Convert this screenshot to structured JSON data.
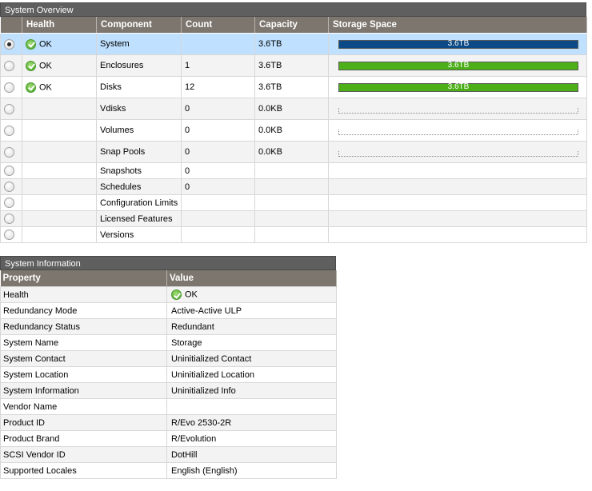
{
  "overview": {
    "title": "System Overview",
    "columns": {
      "select": "",
      "health": "Health",
      "component": "Component",
      "count": "Count",
      "capacity": "Capacity",
      "storage": "Storage Space"
    },
    "rows": [
      {
        "selected": true,
        "health": "OK",
        "component": "System",
        "count": "",
        "capacity": "3.6TB",
        "bar": "blue",
        "bar_label": "3.6TB",
        "fill": 1.0
      },
      {
        "selected": false,
        "health": "OK",
        "component": "Enclosures",
        "count": "1",
        "capacity": "3.6TB",
        "bar": "green",
        "bar_label": "3.6TB",
        "fill": 1.0
      },
      {
        "selected": false,
        "health": "OK",
        "component": "Disks",
        "count": "12",
        "capacity": "3.6TB",
        "bar": "green",
        "bar_label": "3.6TB",
        "fill": 1.0
      },
      {
        "selected": false,
        "health": "",
        "component": "Vdisks",
        "count": "0",
        "capacity": "0.0KB",
        "bar": "empty",
        "bar_label": "",
        "fill": 0
      },
      {
        "selected": false,
        "health": "",
        "component": "Volumes",
        "count": "0",
        "capacity": "0.0KB",
        "bar": "empty",
        "bar_label": "",
        "fill": 0
      },
      {
        "selected": false,
        "health": "",
        "component": "Snap Pools",
        "count": "0",
        "capacity": "0.0KB",
        "bar": "empty",
        "bar_label": "",
        "fill": 0
      },
      {
        "selected": false,
        "health": "",
        "component": "Snapshots",
        "count": "0",
        "capacity": "",
        "bar": "none",
        "bar_label": "",
        "fill": 0
      },
      {
        "selected": false,
        "health": "",
        "component": "Schedules",
        "count": "0",
        "capacity": "",
        "bar": "none",
        "bar_label": "",
        "fill": 0
      },
      {
        "selected": false,
        "health": "",
        "component": "Configuration Limits",
        "count": "",
        "capacity": "",
        "bar": "none",
        "bar_label": "",
        "fill": 0
      },
      {
        "selected": false,
        "health": "",
        "component": "Licensed Features",
        "count": "",
        "capacity": "",
        "bar": "none",
        "bar_label": "",
        "fill": 0
      },
      {
        "selected": false,
        "health": "",
        "component": "Versions",
        "count": "",
        "capacity": "",
        "bar": "none",
        "bar_label": "",
        "fill": 0
      }
    ]
  },
  "info": {
    "title": "System Information",
    "columns": {
      "property": "Property",
      "value": "Value"
    },
    "rows": [
      {
        "property": "Health",
        "value": "OK",
        "icon": "ok-icon"
      },
      {
        "property": "Redundancy Mode",
        "value": "Active-Active ULP"
      },
      {
        "property": "Redundancy Status",
        "value": "Redundant"
      },
      {
        "property": "System Name",
        "value": "Storage"
      },
      {
        "property": "System Contact",
        "value": "Uninitialized Contact"
      },
      {
        "property": "System Location",
        "value": "Uninitialized Location"
      },
      {
        "property": "System Information",
        "value": "Uninitialized Info"
      },
      {
        "property": "Vendor Name",
        "value": ""
      },
      {
        "property": "Product ID",
        "value": "R/Evo 2530-2R"
      },
      {
        "property": "Product Brand",
        "value": "R/Evolution"
      },
      {
        "property": "SCSI Vendor ID",
        "value": "DotHill"
      },
      {
        "property": "Supported Locales",
        "value": "English (English)"
      }
    ]
  },
  "colors": {
    "header": "#7d766e",
    "title_bar": "#5f5f5f",
    "selected_row": "#bfe0ff",
    "bar_blue": "#0b4a86",
    "bar_green": "#4db019",
    "ok_green": "#5cb23a"
  }
}
